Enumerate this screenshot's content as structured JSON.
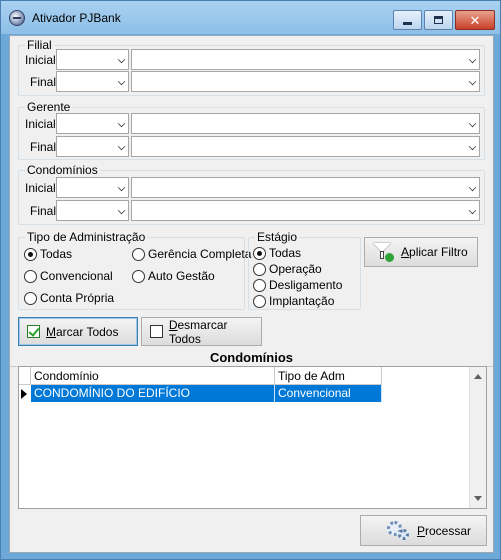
{
  "window": {
    "title": "Ativador PJBank",
    "icon": "app-globe-icon"
  },
  "titlebar_buttons": {
    "minimize": "minimize-icon",
    "maximize": "maximize-icon",
    "close": "close-icon"
  },
  "filial": {
    "legend": "Filial",
    "inicial_label": "Inicial",
    "final_label": "Final"
  },
  "gerente": {
    "legend": "Gerente",
    "inicial_label": "Inicial",
    "final_label": "Final"
  },
  "condominios_filter": {
    "legend": "Condomínios",
    "inicial_label": "Inicial",
    "final_label": "Final"
  },
  "tipo_adm": {
    "legend": "Tipo de Administração",
    "options": [
      {
        "label": "Todas",
        "selected": true
      },
      {
        "label": "Gerência Completa",
        "selected": false
      },
      {
        "label": "Convencional",
        "selected": false
      },
      {
        "label": "Auto Gestão",
        "selected": false
      },
      {
        "label": "Conta Própria",
        "selected": false
      }
    ]
  },
  "estagio": {
    "legend": "Estágio",
    "options": [
      {
        "label": "Todas",
        "selected": true
      },
      {
        "label": "Operação",
        "selected": false
      },
      {
        "label": "Desligamento",
        "selected": false
      },
      {
        "label": "Implantação",
        "selected": false
      }
    ]
  },
  "buttons": {
    "aplicar_filtro": {
      "label_underlined": "A",
      "label_rest": "plicar Filtro"
    },
    "marcar_todos": {
      "label_underlined": "M",
      "label_rest": "arcar Todos"
    },
    "desmarcar_todos": {
      "label_underlined": "D",
      "label_rest": "esmarcar Todos"
    },
    "processar": {
      "label_underlined": "P",
      "label_rest": "rocessar"
    }
  },
  "grid": {
    "title": "Condomínios",
    "columns": [
      "Condomínio",
      "Tipo de Adm"
    ],
    "rows": [
      {
        "condominio": "CONDOMÍNIO DO EDIFÍCIO",
        "tipo_adm": "Convencional",
        "selected": true
      }
    ]
  }
}
